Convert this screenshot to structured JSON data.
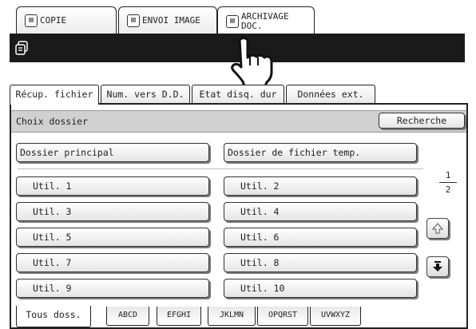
{
  "mode_tabs": [
    {
      "label": "COPIE"
    },
    {
      "label": "ENVOI IMAGE"
    },
    {
      "label": "ARCHIVAGE\nDOC."
    }
  ],
  "file_tabs": [
    {
      "label": "Récup. fichier",
      "active": true
    },
    {
      "label": "Num. vers D.D."
    },
    {
      "label": "Etat disq. dur"
    },
    {
      "label": "Données ext."
    }
  ],
  "header": {
    "title": "Choix dossier",
    "search_label": "Recherche"
  },
  "folders": {
    "main": "Dossier principal",
    "temp": "Dossier de fichier temp.",
    "users": [
      "Util. 1",
      "Util. 2",
      "Util. 3",
      "Util. 4",
      "Util. 5",
      "Util. 6",
      "Util. 7",
      "Util. 8",
      "Util. 9",
      "Util. 10"
    ]
  },
  "pager": {
    "current": "1",
    "total": "2"
  },
  "index_tabs": [
    {
      "label": "Tous doss.",
      "active": true
    },
    {
      "label": "ABCD"
    },
    {
      "label": "EFGHI"
    },
    {
      "label": "JKLMN"
    },
    {
      "label": "OPQRST"
    },
    {
      "label": "UVWXYZ"
    }
  ],
  "icons": {
    "bar": "document-filing-icon",
    "pointer": "hand-pointer-icon",
    "up": "arrow-up-icon",
    "down": "arrow-down-icon"
  }
}
